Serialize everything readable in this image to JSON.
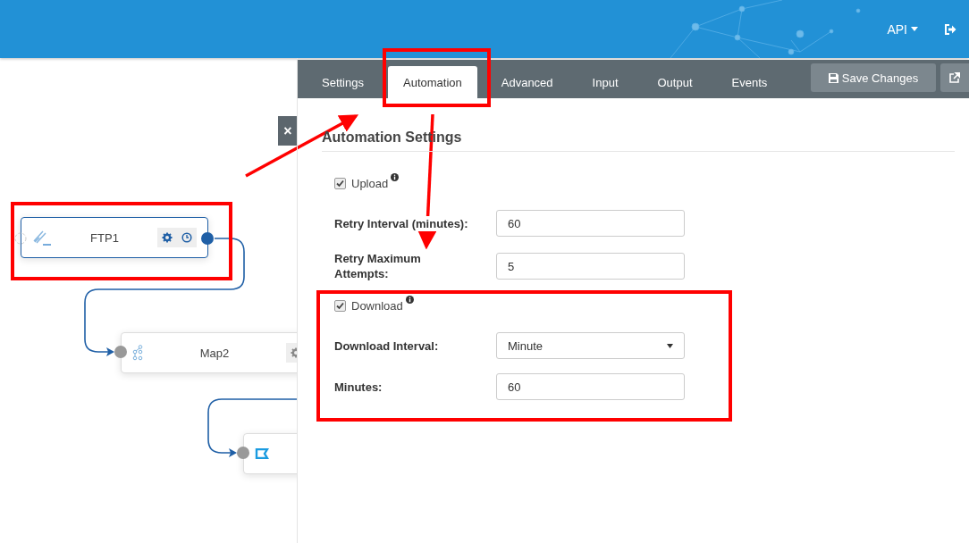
{
  "header": {
    "user_menu": "API"
  },
  "canvas": {
    "nodes": [
      {
        "kind": "ftp",
        "label": "FTP1",
        "selected": true
      },
      {
        "kind": "map",
        "label": "Map2",
        "selected": false
      },
      {
        "kind": "endpoint",
        "selected": false
      }
    ],
    "close_button": "×"
  },
  "panel": {
    "tabs": [
      {
        "label": "Settings",
        "selected": false
      },
      {
        "label": "Automation",
        "selected": true
      },
      {
        "label": "Advanced",
        "selected": false
      },
      {
        "label": "Input",
        "selected": false
      },
      {
        "label": "Output",
        "selected": false
      },
      {
        "label": "Events",
        "selected": false
      }
    ],
    "save_button": "Save Changes",
    "heading": "Automation Settings",
    "fields": [
      {
        "kind": "checkbox",
        "label": "Upload",
        "checked": true
      },
      {
        "kind": "text",
        "label": "Retry Interval (minutes):",
        "value": "60"
      },
      {
        "kind": "text",
        "label": "Retry Maximum Attempts:",
        "value": "5"
      },
      {
        "kind": "checkbox",
        "label": "Download",
        "checked": true
      },
      {
        "kind": "select",
        "label": "Download Interval:",
        "value": "Minute"
      },
      {
        "kind": "text",
        "label": "Minutes:",
        "value": "60"
      }
    ]
  }
}
